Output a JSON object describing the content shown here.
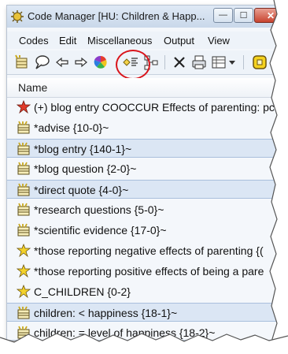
{
  "window": {
    "title": "Code Manager [HU: Children & Happ...",
    "buttons": {
      "minimize": "—",
      "maximize": "☐",
      "close": "✕"
    }
  },
  "menu": [
    "Codes",
    "Edit",
    "Miscellaneous",
    "Output",
    "View"
  ],
  "toolbar": {
    "icons": [
      "new-code-icon",
      "comment-icon",
      "back-arrow-icon",
      "forward-arrow-icon",
      "color-wheel-icon",
      "code-filter-icon",
      "network-icon",
      "delete-icon",
      "print-icon",
      "view-options-icon",
      "view-dropdown-icon",
      "code-icon"
    ]
  },
  "annotation": {
    "circle_color": "#d9141b",
    "circled_item": "code-filter-icon"
  },
  "list": {
    "header": "Name",
    "rows": [
      {
        "text": "(+) blog entry COOCCUR Effects of parenting: pc",
        "icon": "code-cooccur-icon",
        "selected": false
      },
      {
        "text": "*advise {10-0}~",
        "icon": "code-icon",
        "selected": false
      },
      {
        "text": "*blog entry {140-1}~",
        "icon": "code-icon",
        "selected": true
      },
      {
        "text": "*blog question {2-0}~",
        "icon": "code-icon",
        "selected": false
      },
      {
        "text": "*direct quote {4-0}~",
        "icon": "code-icon",
        "selected": true
      },
      {
        "text": "*research questions {5-0}~",
        "icon": "code-icon",
        "selected": false
      },
      {
        "text": "*scientific evidence {17-0}~",
        "icon": "code-icon",
        "selected": false
      },
      {
        "text": "*those reporting negative effects of parenting {(",
        "icon": "code-yellow-icon",
        "selected": false
      },
      {
        "text": "*those reporting positive effects of being a pare",
        "icon": "code-yellow-icon",
        "selected": false
      },
      {
        "text": "C_CHILDREN {0-2}",
        "icon": "code-yellow-icon",
        "selected": false
      },
      {
        "text": "children: < happiness {18-1}~",
        "icon": "code-icon",
        "selected": true
      },
      {
        "text": "children: = level of happiness {18-2}~",
        "icon": "code-icon",
        "selected": false
      }
    ]
  },
  "colors": {
    "selection": "#dbe6f4",
    "titlebar": "#c9d8ea",
    "close_button": "#c8442f"
  }
}
